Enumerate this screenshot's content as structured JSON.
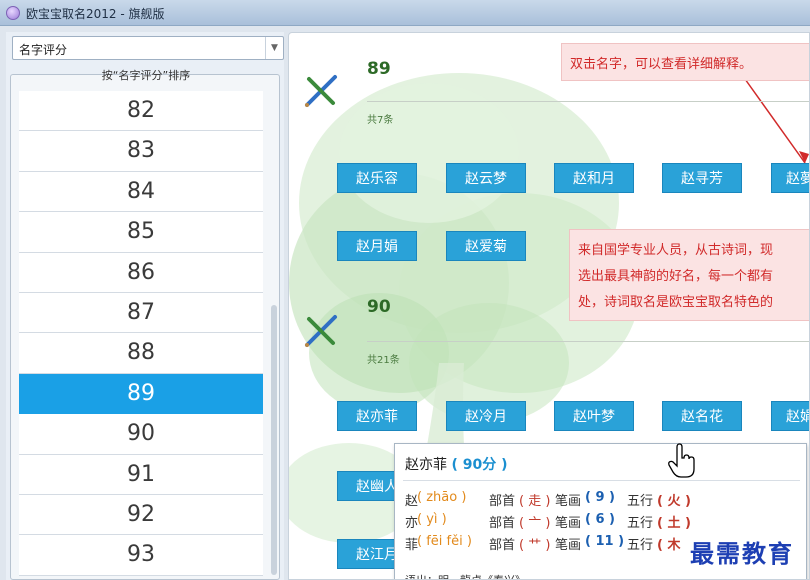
{
  "window": {
    "title": "欧宝宝取名2012 - 旗舰版"
  },
  "sort_select": {
    "value": "名字评分"
  },
  "list": {
    "caption": "按“名字评分”排序",
    "items": [
      "82",
      "83",
      "84",
      "85",
      "86",
      "87",
      "88",
      "89",
      "90",
      "91",
      "92",
      "93"
    ],
    "selected": "89"
  },
  "groups": [
    {
      "score": "89",
      "count_label": "共7条",
      "names": [
        "赵乐容",
        "赵云梦",
        "赵和月",
        "赵寻芳",
        "赵夢",
        "赵月娟",
        "赵爱菊"
      ]
    },
    {
      "score": "90",
      "count_label": "共21条",
      "names": [
        "赵亦菲",
        "赵冷月",
        "赵叶梦",
        "赵名花",
        "赵娟",
        "赵幽人",
        "赵江月"
      ]
    }
  ],
  "notes": {
    "top": "双击名字，可以查看详细解释。",
    "mid_lines": [
      "来自国学专业人员，从古诗词，现",
      "选出最具神韵的好名，每一个都有",
      "处，诗词取名是欧宝宝取名特色的"
    ]
  },
  "tooltip": {
    "name": "赵亦菲",
    "score": "( 90分 )",
    "rows": [
      {
        "char": "赵",
        "pinyin": "( zhāo )",
        "bushou_label": "部首",
        "bushou": "( 走 )",
        "bihua_label": "笔画",
        "bihua": "( 9 )",
        "wuxing_label": "五行",
        "wuxing": "( 火 )"
      },
      {
        "char": "亦",
        "pinyin": "( yì )",
        "bushou_label": "部首",
        "bushou": "( 亠 )",
        "bihua_label": "笔画",
        "bihua": "( 6 )",
        "wuxing_label": "五行",
        "wuxing": "( 土 )"
      },
      {
        "char": "菲",
        "pinyin": "( fēi fěi )",
        "bushou_label": "部首",
        "bushou": "( 艹 )",
        "bihua_label": "笔画",
        "bihua": "( 11 )",
        "wuxing_label": "五行",
        "wuxing": "( 木"
      }
    ],
    "source": "语出：明．龍卓《春兴》"
  },
  "watermark": "最需教育",
  "colors": {
    "selected": "#1aa0e6",
    "button": "#2aa2d8",
    "note_text": "#d12a2a",
    "score_green": "#2d6a27"
  }
}
